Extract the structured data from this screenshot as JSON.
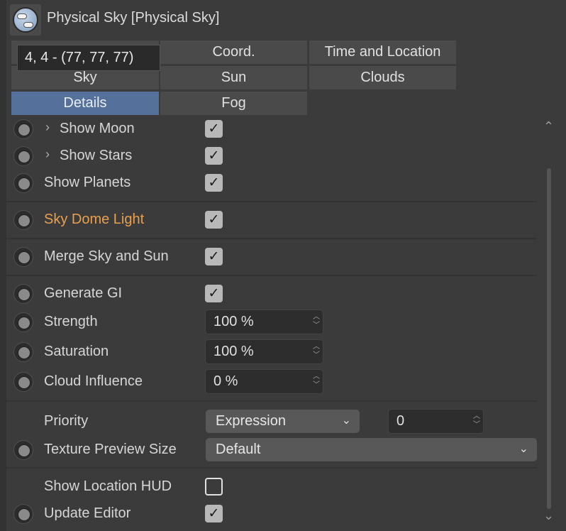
{
  "header": {
    "title": "Physical Sky [Physical Sky]",
    "icon": "physical-sky-icon"
  },
  "tooltip": "4, 4 - (77, 77, 77)",
  "tabs": [
    {
      "label": ""
    },
    {
      "label": "Coord."
    },
    {
      "label": "Time and Location"
    },
    {
      "label": "Sky"
    },
    {
      "label": "Sun"
    },
    {
      "label": "Clouds"
    },
    {
      "label": "Details",
      "selected": true
    },
    {
      "label": "Fog"
    }
  ],
  "rows": {
    "show_moon": {
      "label": "Show Moon",
      "checked": true
    },
    "show_stars": {
      "label": "Show Stars",
      "checked": true
    },
    "show_planets": {
      "label": "Show Planets",
      "checked": true
    },
    "sky_dome_light": {
      "label": "Sky Dome Light",
      "checked": true
    },
    "merge": {
      "label": "Merge Sky and Sun",
      "checked": true
    },
    "generate_gi": {
      "label": "Generate GI",
      "checked": true
    },
    "strength": {
      "label": "Strength",
      "value": "100 %"
    },
    "saturation": {
      "label": "Saturation",
      "value": "100 %"
    },
    "cloud_influence": {
      "label": "Cloud Influence",
      "value": "0 %"
    },
    "priority": {
      "label": "Priority",
      "mode": "Expression",
      "value": "0"
    },
    "texture_preview": {
      "label": "Texture Preview Size",
      "value": "Default"
    },
    "show_location_hud": {
      "label": "Show Location HUD",
      "checked": false
    },
    "update_editor": {
      "label": "Update Editor",
      "checked": true
    }
  },
  "colors": {
    "accent_tab": "#55709a",
    "highlight_label": "#e8a050"
  },
  "glyphs": {
    "check": "✓",
    "chev_right": "›",
    "chev_down": "⌄",
    "up": "⌃",
    "spin_up": "︿",
    "spin_down": "﹀"
  }
}
